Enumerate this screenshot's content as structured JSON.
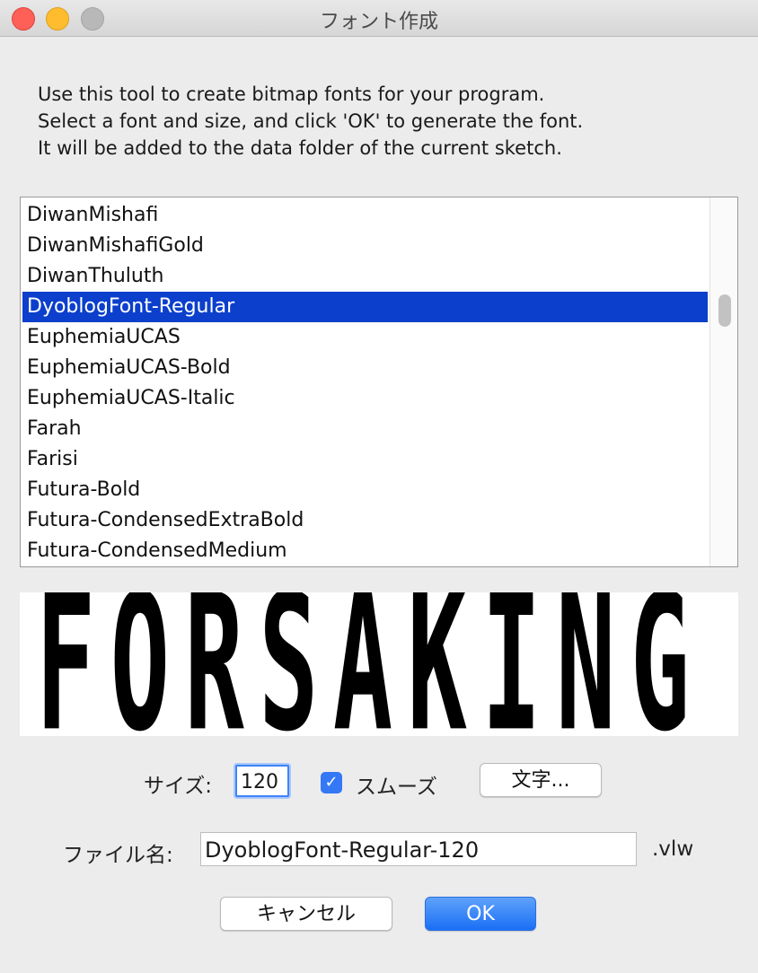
{
  "window": {
    "title": "フォント作成"
  },
  "instructions": {
    "line1": "Use this tool to create bitmap fonts for your program.",
    "line2": "Select a font and size, and click 'OK' to generate the font.",
    "line3": "It will be added to the data folder of the current sketch."
  },
  "font_list": {
    "items": [
      "DiwanMishafi",
      "DiwanMishafiGold",
      "DiwanThuluth",
      "DyoblogFont-Regular",
      "EuphemiaUCAS",
      "EuphemiaUCAS-Bold",
      "EuphemiaUCAS-Italic",
      "Farah",
      "Farisi",
      "Futura-Bold",
      "Futura-CondensedExtraBold",
      "Futura-CondensedMedium"
    ],
    "selected": "DyoblogFont-Regular"
  },
  "preview": {
    "text": "FORSAKING I"
  },
  "controls": {
    "size_label": "サイズ:",
    "size_value": "120",
    "smooth_checked": true,
    "smooth_label": "スムーズ",
    "characters_button": "文字...",
    "filename_label": "ファイル名:",
    "filename_value": "DyoblogFont-Regular-120",
    "extension": ".vlw",
    "cancel_button": "キャンセル",
    "ok_button": "OK"
  },
  "colors": {
    "selection": "#0c3fcc",
    "accent": "#3478f6",
    "close": "#fe5f57",
    "minimize": "#febc2e",
    "zoom_disabled": "#b8b8b8"
  }
}
